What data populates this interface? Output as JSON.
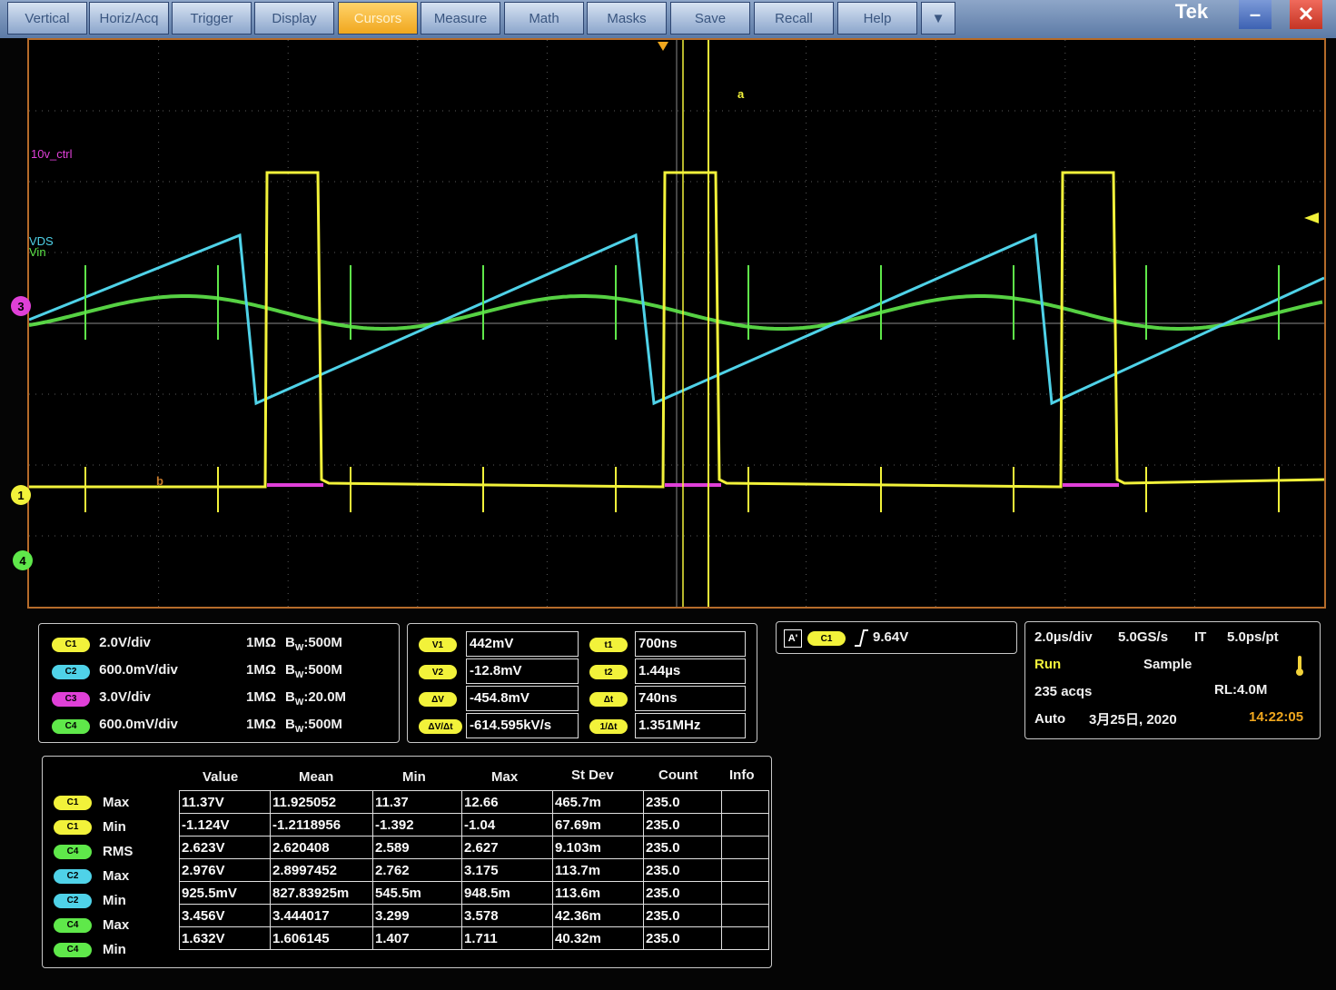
{
  "menu": {
    "items": [
      "Vertical",
      "Horiz/Acq",
      "Trigger",
      "Display",
      "Cursors",
      "Measure",
      "Math",
      "Masks",
      "Save",
      "Recall",
      "Help"
    ],
    "active": "Cursors",
    "more_glyph": "▼",
    "logo": "Tek",
    "minimize_glyph": "–",
    "close_glyph": "✕"
  },
  "colors": {
    "ch1": "#f2f23a",
    "ch2": "#4fd2e8",
    "ch3": "#e040d8",
    "ch4": "#5fe84a",
    "accent": "#f0a71e"
  },
  "graticule": {
    "ch3_label": "10v_ctrl",
    "ch2_label": "VDS",
    "ch4_label": "Vin",
    "markers": {
      "ch1": "1",
      "ch3": "3",
      "ch4": "4"
    },
    "cursor_a": "a",
    "cursor_b": "b"
  },
  "channels": [
    {
      "pill": "C1",
      "scale": "2.0V/div",
      "impedance": "1MΩ",
      "bw_prefix": "B",
      "bw_sub": "W",
      "bw": ":500M"
    },
    {
      "pill": "C2",
      "scale": "600.0mV/div",
      "impedance": "1MΩ",
      "bw_prefix": "B",
      "bw_sub": "W",
      "bw": ":500M"
    },
    {
      "pill": "C3",
      "scale": "3.0V/div",
      "impedance": "1MΩ",
      "bw_prefix": "B",
      "bw_sub": "W",
      "bw": ":20.0M"
    },
    {
      "pill": "C4",
      "scale": "600.0mV/div",
      "impedance": "1MΩ",
      "bw_prefix": "B",
      "bw_sub": "W",
      "bw": ":500M"
    }
  ],
  "cursors": {
    "v1_label": "V1",
    "v1": "442mV",
    "v2_label": "V2",
    "v2": "-12.8mV",
    "dv_label": "ΔV",
    "dv": "-454.8mV",
    "dvdt_label": "ΔV/Δt",
    "dvdt": "-614.595kV/s",
    "t1_label": "t1",
    "t1": "700ns",
    "t2_label": "t2",
    "t2": "1.44µs",
    "dt_label": "Δt",
    "dt": "740ns",
    "inv_label": "1/Δt",
    "inv": "1.351MHz"
  },
  "trigger": {
    "mode": "A'",
    "source": "C1",
    "level": "9.64V"
  },
  "acquisition": {
    "timebase": "2.0µs/div",
    "rate": "5.0GS/s",
    "it": "IT",
    "res": "5.0ps/pt",
    "state": "Run",
    "mode": "Sample",
    "acqs": "235 acqs",
    "rl": "RL:4.0M",
    "trigger_mode": "Auto",
    "date": "3月25日, 2020",
    "time": "14:22:05"
  },
  "measurements": {
    "headers": [
      "Value",
      "Mean",
      "Min",
      "Max",
      "St Dev",
      "Count",
      "Info"
    ],
    "rows": [
      {
        "ch": "C1",
        "type": "Max",
        "value": "11.37V",
        "mean": "11.925052",
        "min": "11.37",
        "max": "12.66",
        "stdev": "465.7m",
        "count": "235.0",
        "info": ""
      },
      {
        "ch": "C1",
        "type": "Min",
        "value": "-1.124V",
        "mean": "-1.2118956",
        "min": "-1.392",
        "max": "-1.04",
        "stdev": "67.69m",
        "count": "235.0",
        "info": ""
      },
      {
        "ch": "C4",
        "type": "RMS",
        "value": "2.623V",
        "mean": "2.620408",
        "min": "2.589",
        "max": "2.627",
        "stdev": "9.103m",
        "count": "235.0",
        "info": ""
      },
      {
        "ch": "C2",
        "type": "Max",
        "value": "2.976V",
        "mean": "2.8997452",
        "min": "2.762",
        "max": "3.175",
        "stdev": "113.7m",
        "count": "235.0",
        "info": ""
      },
      {
        "ch": "C2",
        "type": "Min",
        "value": "925.5mV",
        "mean": "827.83925m",
        "min": "545.5m",
        "max": "948.5m",
        "stdev": "113.6m",
        "count": "235.0",
        "info": ""
      },
      {
        "ch": "C4",
        "type": "Max",
        "value": "3.456V",
        "mean": "3.444017",
        "min": "3.299",
        "max": "3.578",
        "stdev": "42.36m",
        "count": "235.0",
        "info": ""
      },
      {
        "ch": "C4",
        "type": "Min",
        "value": "1.632V",
        "mean": "1.606145",
        "min": "1.407",
        "max": "1.711",
        "stdev": "40.32m",
        "count": "235.0",
        "info": ""
      }
    ]
  }
}
